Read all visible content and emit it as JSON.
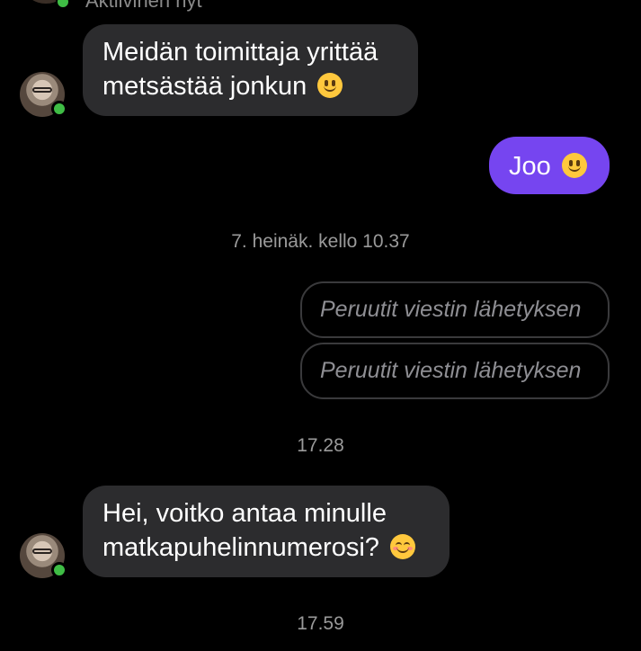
{
  "header": {
    "status_text": "Aktiivinen nyt"
  },
  "messages": [
    {
      "direction": "incoming",
      "text": "Meidän toimittaja yrittää metsästää jonkun",
      "line1": "Meidän toimittaja yrittää",
      "line2": "metsästää jonkun",
      "emoji": "slightly-smiling-face"
    },
    {
      "direction": "outgoing",
      "text": "Joo",
      "emoji": "slightly-smiling-face"
    },
    {
      "type": "timestamp",
      "text": "7. heinäk. kello 10.37"
    },
    {
      "direction": "outgoing",
      "type": "unsent",
      "text": "Peruutit viestin lähetyksen"
    },
    {
      "direction": "outgoing",
      "type": "unsent",
      "text": "Peruutit viestin lähetyksen"
    },
    {
      "type": "timestamp",
      "text": "17.28"
    },
    {
      "direction": "incoming",
      "text": "Hei, voitko antaa minulle matkapuhelinnumerosi?",
      "line1": "Hei, voitko antaa minulle",
      "line2": "matkapuhelinnumerosi?",
      "emoji": "smiling-face-with-blush"
    },
    {
      "type": "timestamp",
      "text": "17.59"
    }
  ],
  "colors": {
    "background": "#000000",
    "incoming_bubble": "#2c2c2e",
    "outgoing_bubble": "#7645f0",
    "online_indicator": "#3fbd45",
    "timestamp_text": "#9a9a9a"
  }
}
